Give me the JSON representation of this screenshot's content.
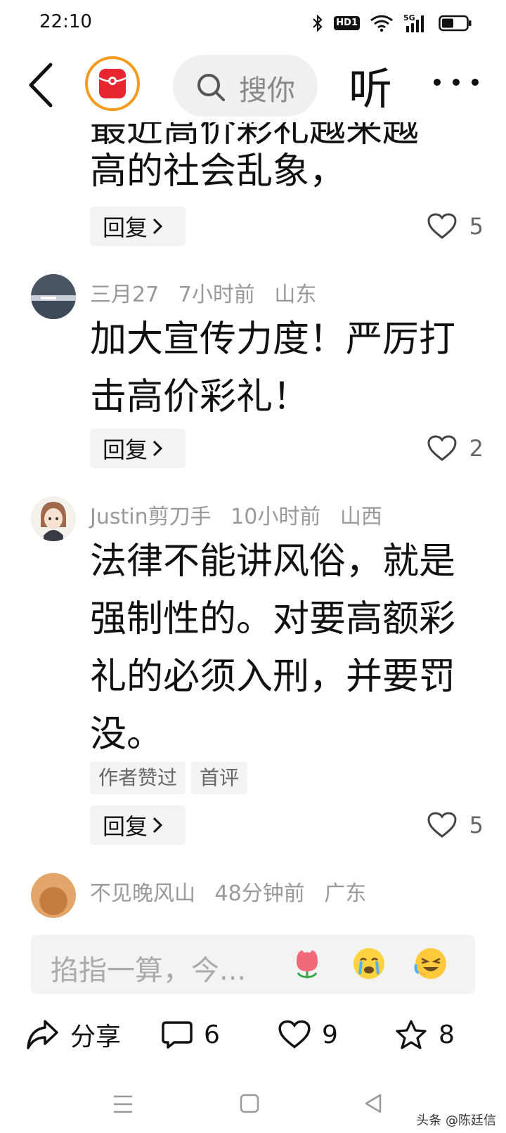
{
  "status_bar": {
    "time": "22:10",
    "network": "5G",
    "hd_label": "HD1"
  },
  "nav": {
    "search_placeholder": "搜你",
    "listen_label": "听"
  },
  "clipped_comment": {
    "line_partial": "最近高价彩礼越来越",
    "line_last": "高的社会乱象，",
    "reply_label": "回复",
    "likes": "5"
  },
  "comments": [
    {
      "user": "三月27",
      "time": "7小时前",
      "location": "山东",
      "text": "加大宣传力度！严厉打击高价彩礼！",
      "reply_label": "回复",
      "likes": "2"
    },
    {
      "user": "Justin剪刀手",
      "time": "10小时前",
      "location": "山西",
      "text": "法律不能讲风俗，就是强制性的。对要高额彩礼的必须入刑，并要罚没。",
      "tags": [
        "作者赞过",
        "首评"
      ],
      "reply_label": "回复",
      "likes": "5"
    },
    {
      "user": "不见晚风山",
      "time": "48分钟前",
      "location": "广东"
    }
  ],
  "input": {
    "placeholder": "掐指一算，今..."
  },
  "actions": {
    "share_label": "分享",
    "comments_count": "6",
    "likes_count": "9",
    "favorites_count": "8"
  },
  "watermark": "头条 @陈廷信",
  "colors": {
    "accent_red": "#e8262f",
    "ring_orange": "#f39a1f",
    "muted": "#999999"
  }
}
